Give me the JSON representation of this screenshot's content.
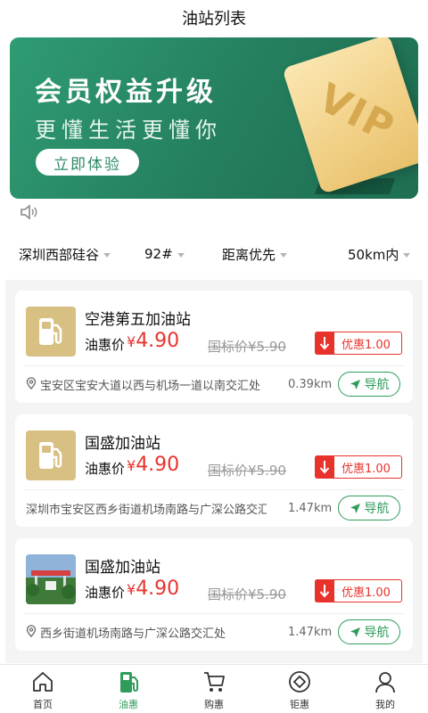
{
  "header": {
    "title": "油站列表"
  },
  "banner": {
    "title": "会员权益升级",
    "subtitle": "更懂生活更懂你",
    "cta": "立即体验",
    "card_text": "VIP"
  },
  "filters": [
    {
      "label": "深圳西部硅谷"
    },
    {
      "label": "92#"
    },
    {
      "label": "距离优先"
    },
    {
      "label": "50km内"
    }
  ],
  "stations": [
    {
      "name": "空港第五加油站",
      "price_label": "油惠价",
      "currency": "¥",
      "price": "4.90",
      "standard_price": "国标价¥5.90",
      "discount": "优惠1.00",
      "address": "宝安区宝安大道以西与机场一道以南交汇处",
      "distance": "0.39km",
      "nav": "导航",
      "thumb": "fuel-icon"
    },
    {
      "name": "国盛加油站",
      "price_label": "油惠价",
      "currency": "¥",
      "price": "4.90",
      "standard_price": "国标价¥5.90",
      "discount": "优惠1.00",
      "address": "深圳市宝安区西乡街道机场南路与广深公路交汇",
      "distance": "1.47km",
      "nav": "导航",
      "thumb": "fuel-icon"
    },
    {
      "name": "国盛加油站",
      "price_label": "油惠价",
      "currency": "¥",
      "price": "4.90",
      "standard_price": "国标价¥5.90",
      "discount": "优惠1.00",
      "address": "西乡街道机场南路与广深公路交汇处",
      "distance": "1.47km",
      "nav": "导航",
      "thumb": "station-photo"
    }
  ],
  "tabbar": [
    {
      "label": "首页",
      "icon": "home-icon"
    },
    {
      "label": "油惠",
      "icon": "fuel-pump-icon",
      "active": true
    },
    {
      "label": "购惠",
      "icon": "cart-icon"
    },
    {
      "label": "钜惠",
      "icon": "diamond-icon"
    },
    {
      "label": "我的",
      "icon": "user-icon"
    }
  ],
  "colors": {
    "brand_green": "#2f9c5b",
    "price_red": "#e8332d",
    "gold": "#d8bf82"
  }
}
